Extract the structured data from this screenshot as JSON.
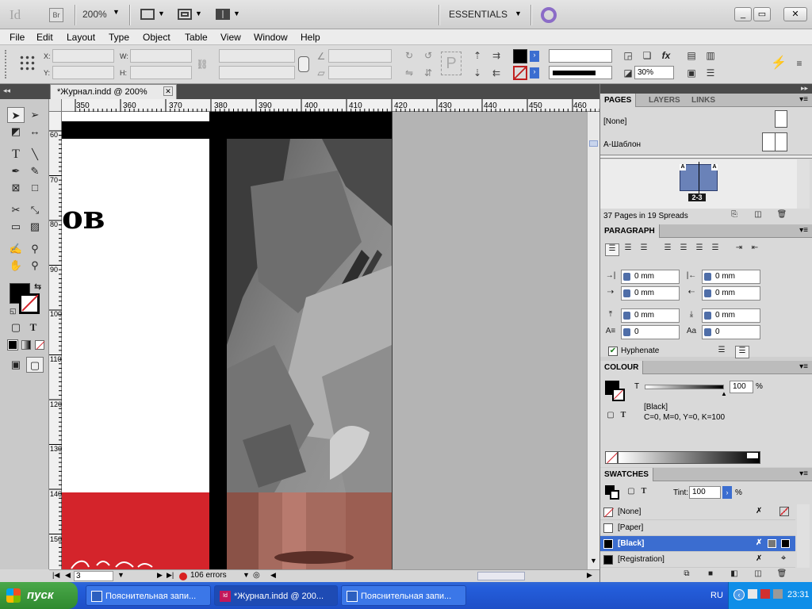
{
  "titlebar": {
    "app_icon": "Id",
    "bridge_label": "Br",
    "zoom": "200%",
    "workspace": "ESSENTIALS",
    "window_controls": {
      "minimize": "_",
      "restore": "▭",
      "close": "✕"
    }
  },
  "menu": [
    "File",
    "Edit",
    "Layout",
    "Type",
    "Object",
    "Table",
    "View",
    "Window",
    "Help"
  ],
  "control": {
    "x_label": "X:",
    "y_label": "Y:",
    "w_label": "W:",
    "h_label": "H:",
    "opacity": "30%"
  },
  "document_tab": {
    "title": "*Журнал.indd @ 200%",
    "close": "✕"
  },
  "ruler": {
    "h_ticks": [
      "350",
      "360",
      "370",
      "380",
      "390",
      "400",
      "410",
      "420",
      "430",
      "440",
      "450",
      "460"
    ],
    "v_ticks": [
      "60",
      "70",
      "80",
      "90",
      "100",
      "110",
      "120",
      "130",
      "140",
      "150"
    ]
  },
  "page_text": "ов",
  "status": {
    "page": "3",
    "errors": "106 errors"
  },
  "pages_panel": {
    "tabs": [
      "PAGES",
      "LAYERS",
      "LINKS"
    ],
    "master_none": "[None]",
    "master_a": "A-Шаблон",
    "spread_label": "2-3",
    "footer": "37 Pages in 19 Spreads"
  },
  "paragraph_panel": {
    "title": "PARAGRAPH",
    "left_indent": "0 mm",
    "right_indent": "0 mm",
    "first_line": "0 mm",
    "last_line": "0 mm",
    "space_before": "0 mm",
    "space_after": "0 mm",
    "drop_lines": "0",
    "drop_chars": "0",
    "hyphenate": "Hyphenate"
  },
  "colour_panel": {
    "title": "COLOUR",
    "tint_label": "T",
    "tint_value": "100",
    "percent": "%",
    "swatch_name": "[Black]",
    "cmyk": "C=0, M=0, Y=0, K=100"
  },
  "swatches_panel": {
    "title": "SWATCHES",
    "tint_label": "Tint:",
    "tint_value": "100",
    "percent": "%",
    "rows": [
      {
        "name": "[None]",
        "color": "none"
      },
      {
        "name": "[Paper]",
        "color": "#ffffff"
      },
      {
        "name": "[Black]",
        "color": "#000000"
      },
      {
        "name": "[Registration]",
        "color": "#000000"
      }
    ]
  },
  "taskbar": {
    "start": "пуск",
    "tasks": [
      "Пояснительная запи...",
      "*Журнал.indd @ 200...",
      "Пояснительная запи..."
    ],
    "lang": "RU",
    "time": "23:31"
  },
  "colors": {
    "accent_red": "#d4242b",
    "selection_blue": "#3b6dd0"
  }
}
